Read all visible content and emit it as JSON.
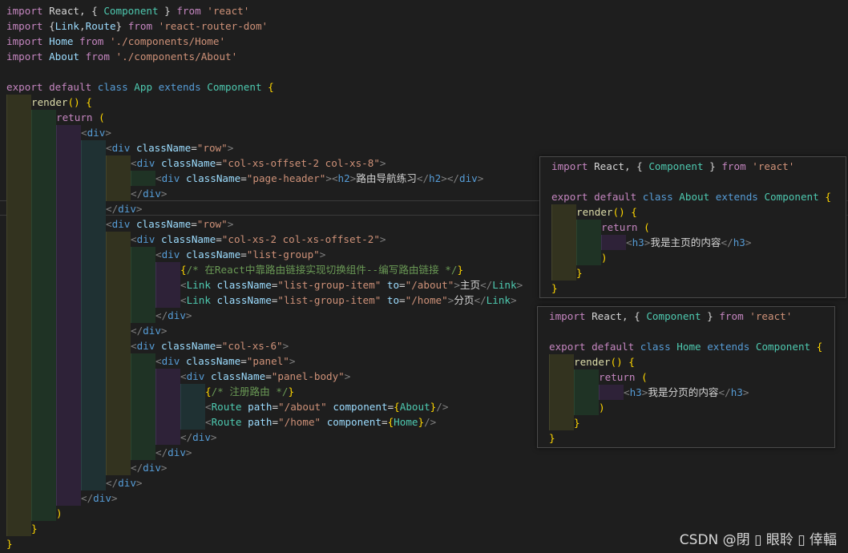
{
  "main_code": {
    "lines": [
      [
        [
          "k",
          "import"
        ],
        [
          "w",
          " React, { "
        ],
        [
          "t",
          "Component"
        ],
        [
          "w",
          " } "
        ],
        [
          "k",
          "from"
        ],
        [
          "w",
          " "
        ],
        [
          "s",
          "'react'"
        ]
      ],
      [
        [
          "k",
          "import"
        ],
        [
          "w",
          " {"
        ],
        [
          "v",
          "Link"
        ],
        [
          "w",
          ","
        ],
        [
          "v",
          "Route"
        ],
        [
          "w",
          "} "
        ],
        [
          "k",
          "from"
        ],
        [
          "w",
          " "
        ],
        [
          "s",
          "'react-router-dom'"
        ]
      ],
      [
        [
          "k",
          "import"
        ],
        [
          "w",
          " "
        ],
        [
          "v",
          "Home"
        ],
        [
          "w",
          " "
        ],
        [
          "k",
          "from"
        ],
        [
          "w",
          " "
        ],
        [
          "s",
          "'./components/Home'"
        ]
      ],
      [
        [
          "k",
          "import"
        ],
        [
          "w",
          " "
        ],
        [
          "v",
          "About"
        ],
        [
          "w",
          " "
        ],
        [
          "k",
          "from"
        ],
        [
          "w",
          " "
        ],
        [
          "s",
          "'./components/About'"
        ]
      ],
      [],
      [
        [
          "k",
          "export"
        ],
        [
          "w",
          " "
        ],
        [
          "k",
          "default"
        ],
        [
          "w",
          " "
        ],
        [
          "b",
          "class"
        ],
        [
          "w",
          " "
        ],
        [
          "t",
          "App"
        ],
        [
          "w",
          " "
        ],
        [
          "b",
          "extends"
        ],
        [
          "w",
          " "
        ],
        [
          "t",
          "Component"
        ],
        [
          "w",
          " "
        ],
        [
          "y",
          "{"
        ]
      ],
      [
        [
          "f",
          "render"
        ],
        [
          "y",
          "()"
        ],
        [
          "w",
          " "
        ],
        [
          "y",
          "{"
        ]
      ],
      [
        [
          "k",
          "return"
        ],
        [
          "w",
          " "
        ],
        [
          "y",
          "("
        ]
      ],
      [
        [
          "p",
          "<"
        ],
        [
          "tg",
          "div"
        ],
        [
          "p",
          ">"
        ]
      ],
      [
        [
          "p",
          "<"
        ],
        [
          "tg",
          "div"
        ],
        [
          "w",
          " "
        ],
        [
          "v",
          "className"
        ],
        [
          "w",
          "="
        ],
        [
          "s",
          "\"row\""
        ],
        [
          "p",
          ">"
        ]
      ],
      [
        [
          "p",
          "<"
        ],
        [
          "tg",
          "div"
        ],
        [
          "w",
          " "
        ],
        [
          "v",
          "className"
        ],
        [
          "w",
          "="
        ],
        [
          "s",
          "\"col-xs-offset-2 col-xs-8\""
        ],
        [
          "p",
          ">"
        ]
      ],
      [
        [
          "p",
          "<"
        ],
        [
          "tg",
          "div"
        ],
        [
          "w",
          " "
        ],
        [
          "v",
          "className"
        ],
        [
          "w",
          "="
        ],
        [
          "s",
          "\"page-header\""
        ],
        [
          "p",
          ">"
        ],
        [
          "p",
          "<"
        ],
        [
          "tg",
          "h2"
        ],
        [
          "p",
          ">"
        ],
        [
          "w",
          "路由导航练习"
        ],
        [
          "p",
          "</"
        ],
        [
          "tg",
          "h2"
        ],
        [
          "p",
          ">"
        ],
        [
          "p",
          "</"
        ],
        [
          "tg",
          "div"
        ],
        [
          "p",
          ">"
        ]
      ],
      [
        [
          "p",
          "</"
        ],
        [
          "tg",
          "div"
        ],
        [
          "p",
          ">"
        ]
      ],
      [
        [
          "p",
          "</"
        ],
        [
          "tg",
          "div"
        ],
        [
          "p",
          ">"
        ]
      ],
      [
        [
          "p",
          "<"
        ],
        [
          "tg",
          "div"
        ],
        [
          "w",
          " "
        ],
        [
          "v",
          "className"
        ],
        [
          "w",
          "="
        ],
        [
          "s",
          "\"row\""
        ],
        [
          "p",
          ">"
        ]
      ],
      [
        [
          "p",
          "<"
        ],
        [
          "tg",
          "div"
        ],
        [
          "w",
          " "
        ],
        [
          "v",
          "className"
        ],
        [
          "w",
          "="
        ],
        [
          "s",
          "\"col-xs-2 col-xs-offset-2\""
        ],
        [
          "p",
          ">"
        ]
      ],
      [
        [
          "p",
          "<"
        ],
        [
          "tg",
          "div"
        ],
        [
          "w",
          " "
        ],
        [
          "v",
          "className"
        ],
        [
          "w",
          "="
        ],
        [
          "s",
          "\"list-group\""
        ],
        [
          "p",
          ">"
        ]
      ],
      [
        [
          "y",
          "{"
        ],
        [
          "c",
          "/* 在React中靠路由链接实现切换组件--编写路由链接 */"
        ],
        [
          "y",
          "}"
        ]
      ],
      [
        [
          "p",
          "<"
        ],
        [
          "t",
          "Link"
        ],
        [
          "w",
          " "
        ],
        [
          "v",
          "className"
        ],
        [
          "w",
          "="
        ],
        [
          "s",
          "\"list-group-item\""
        ],
        [
          "w",
          " "
        ],
        [
          "v",
          "to"
        ],
        [
          "w",
          "="
        ],
        [
          "s",
          "\"/about\""
        ],
        [
          "p",
          ">"
        ],
        [
          "w",
          "主页"
        ],
        [
          "p",
          "</"
        ],
        [
          "t",
          "Link"
        ],
        [
          "p",
          ">"
        ]
      ],
      [
        [
          "p",
          "<"
        ],
        [
          "t",
          "Link"
        ],
        [
          "w",
          " "
        ],
        [
          "v",
          "className"
        ],
        [
          "w",
          "="
        ],
        [
          "s",
          "\"list-group-item\""
        ],
        [
          "w",
          " "
        ],
        [
          "v",
          "to"
        ],
        [
          "w",
          "="
        ],
        [
          "s",
          "\"/home\""
        ],
        [
          "p",
          ">"
        ],
        [
          "w",
          "分页"
        ],
        [
          "p",
          "</"
        ],
        [
          "t",
          "Link"
        ],
        [
          "p",
          ">"
        ]
      ],
      [
        [
          "p",
          "</"
        ],
        [
          "tg",
          "div"
        ],
        [
          "p",
          ">"
        ]
      ],
      [
        [
          "p",
          "</"
        ],
        [
          "tg",
          "div"
        ],
        [
          "p",
          ">"
        ]
      ],
      [
        [
          "p",
          "<"
        ],
        [
          "tg",
          "div"
        ],
        [
          "w",
          " "
        ],
        [
          "v",
          "className"
        ],
        [
          "w",
          "="
        ],
        [
          "s",
          "\"col-xs-6\""
        ],
        [
          "p",
          ">"
        ]
      ],
      [
        [
          "p",
          "<"
        ],
        [
          "tg",
          "div"
        ],
        [
          "w",
          " "
        ],
        [
          "v",
          "className"
        ],
        [
          "w",
          "="
        ],
        [
          "s",
          "\"panel\""
        ],
        [
          "p",
          ">"
        ]
      ],
      [
        [
          "p",
          "<"
        ],
        [
          "tg",
          "div"
        ],
        [
          "w",
          " "
        ],
        [
          "v",
          "className"
        ],
        [
          "w",
          "="
        ],
        [
          "s",
          "\"panel-body\""
        ],
        [
          "p",
          ">"
        ]
      ],
      [
        [
          "y",
          "{"
        ],
        [
          "c",
          "/* 注册路由 */"
        ],
        [
          "y",
          "}"
        ]
      ],
      [
        [
          "p",
          "<"
        ],
        [
          "t",
          "Route"
        ],
        [
          "w",
          " "
        ],
        [
          "v",
          "path"
        ],
        [
          "w",
          "="
        ],
        [
          "s",
          "\"/about\""
        ],
        [
          "w",
          " "
        ],
        [
          "v",
          "component"
        ],
        [
          "w",
          "="
        ],
        [
          "y",
          "{"
        ],
        [
          "t",
          "About"
        ],
        [
          "y",
          "}"
        ],
        [
          "p",
          "/>"
        ]
      ],
      [
        [
          "p",
          "<"
        ],
        [
          "t",
          "Route"
        ],
        [
          "w",
          " "
        ],
        [
          "v",
          "path"
        ],
        [
          "w",
          "="
        ],
        [
          "s",
          "\"/home\""
        ],
        [
          "w",
          " "
        ],
        [
          "v",
          "component"
        ],
        [
          "w",
          "="
        ],
        [
          "y",
          "{"
        ],
        [
          "t",
          "Home"
        ],
        [
          "y",
          "}"
        ],
        [
          "p",
          "/>"
        ]
      ],
      [
        [
          "p",
          "</"
        ],
        [
          "tg",
          "div"
        ],
        [
          "p",
          ">"
        ]
      ],
      [
        [
          "p",
          "</"
        ],
        [
          "tg",
          "div"
        ],
        [
          "p",
          ">"
        ]
      ],
      [
        [
          "p",
          "</"
        ],
        [
          "tg",
          "div"
        ],
        [
          "p",
          ">"
        ]
      ],
      [
        [
          "p",
          "</"
        ],
        [
          "tg",
          "div"
        ],
        [
          "p",
          ">"
        ]
      ],
      [
        [
          "p",
          "</"
        ],
        [
          "tg",
          "div"
        ],
        [
          "p",
          ">"
        ]
      ],
      [
        [
          "y",
          ")"
        ]
      ],
      [
        [
          "y",
          "}"
        ]
      ],
      [
        [
          "y",
          "}"
        ]
      ]
    ]
  },
  "about_panel": {
    "lines": [
      [
        [
          "k",
          "import"
        ],
        [
          "w",
          " React, { "
        ],
        [
          "t",
          "Component"
        ],
        [
          "w",
          " } "
        ],
        [
          "k",
          "from"
        ],
        [
          "w",
          " "
        ],
        [
          "s",
          "'react'"
        ]
      ],
      [],
      [
        [
          "k",
          "export"
        ],
        [
          "w",
          " "
        ],
        [
          "k",
          "default"
        ],
        [
          "w",
          " "
        ],
        [
          "b",
          "class"
        ],
        [
          "w",
          " "
        ],
        [
          "t",
          "About"
        ],
        [
          "w",
          " "
        ],
        [
          "b",
          "extends"
        ],
        [
          "w",
          " "
        ],
        [
          "t",
          "Component"
        ],
        [
          "w",
          " "
        ],
        [
          "y",
          "{"
        ]
      ],
      [
        [
          "f",
          "render"
        ],
        [
          "y",
          "()"
        ],
        [
          "w",
          " "
        ],
        [
          "y",
          "{"
        ]
      ],
      [
        [
          "k",
          "return"
        ],
        [
          "w",
          " "
        ],
        [
          "y",
          "("
        ]
      ],
      [
        [
          "p",
          "<"
        ],
        [
          "tg",
          "h3"
        ],
        [
          "p",
          ">"
        ],
        [
          "w",
          "我是主页的内容"
        ],
        [
          "p",
          "</"
        ],
        [
          "tg",
          "h3"
        ],
        [
          "p",
          ">"
        ]
      ],
      [
        [
          "y",
          ")"
        ]
      ],
      [
        [
          "y",
          "}"
        ]
      ],
      [
        [
          "y",
          "}"
        ]
      ]
    ]
  },
  "home_panel": {
    "lines": [
      [
        [
          "k",
          "import"
        ],
        [
          "w",
          " React, { "
        ],
        [
          "t",
          "Component"
        ],
        [
          "w",
          " } "
        ],
        [
          "k",
          "from"
        ],
        [
          "w",
          " "
        ],
        [
          "s",
          "'react'"
        ]
      ],
      [],
      [
        [
          "k",
          "export"
        ],
        [
          "w",
          " "
        ],
        [
          "k",
          "default"
        ],
        [
          "w",
          " "
        ],
        [
          "b",
          "class"
        ],
        [
          "w",
          " "
        ],
        [
          "t",
          "Home"
        ],
        [
          "w",
          " "
        ],
        [
          "b",
          "extends"
        ],
        [
          "w",
          " "
        ],
        [
          "t",
          "Component"
        ],
        [
          "w",
          " "
        ],
        [
          "y",
          "{"
        ]
      ],
      [
        [
          "f",
          "render"
        ],
        [
          "y",
          "()"
        ],
        [
          "w",
          " "
        ],
        [
          "y",
          "{"
        ]
      ],
      [
        [
          "k",
          "return"
        ],
        [
          "w",
          " "
        ],
        [
          "y",
          "("
        ]
      ],
      [
        [
          "p",
          "<"
        ],
        [
          "tg",
          "h3"
        ],
        [
          "p",
          ">"
        ],
        [
          "w",
          "我是分页的内容"
        ],
        [
          "p",
          "</"
        ],
        [
          "tg",
          "h3"
        ],
        [
          "p",
          ">"
        ]
      ],
      [
        [
          "y",
          ")"
        ]
      ],
      [
        [
          "y",
          "}"
        ]
      ],
      [
        [
          "y",
          "}"
        ]
      ]
    ]
  },
  "watermark": {
    "text": "CSDN @閉 ▯ 眼聆 ▯ 倖輻"
  }
}
